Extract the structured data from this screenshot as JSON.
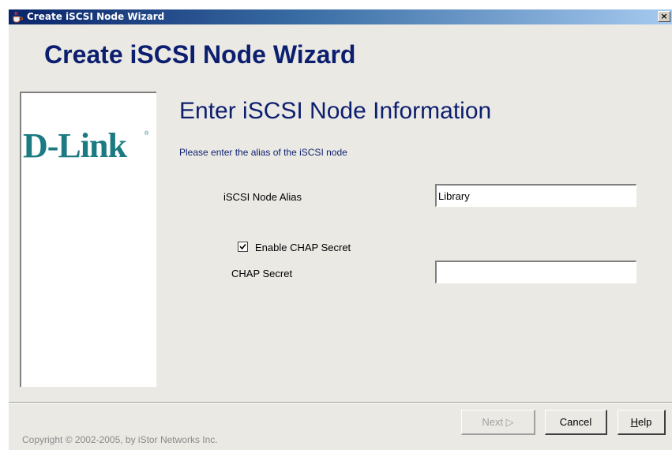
{
  "window": {
    "title": "Create iSCSI Node Wizard",
    "close_label": "×"
  },
  "wizard": {
    "heading": "Create iSCSI Node Wizard",
    "logo_text": "D-Link",
    "logo_reg": "®",
    "step_title": "Enter iSCSI Node Information",
    "instruction": "Please enter the alias of the iSCSI node"
  },
  "form": {
    "alias_label": "iSCSI Node Alias",
    "alias_value": "Library",
    "chap_enable_label": "Enable CHAP Secret",
    "chap_enable_checked": true,
    "chap_secret_label": "CHAP Secret",
    "chap_secret_value": ""
  },
  "footer": {
    "copyright": "Copyright © 2002-2005, by iStor Networks Inc."
  },
  "buttons": {
    "next_label": "Next ▷",
    "cancel_label": "Cancel",
    "help_mnemonic": "H",
    "help_rest": "elp"
  },
  "colors": {
    "heading": "#0c1f6f",
    "logo": "#1b7a82",
    "titlebar_start": "#0a246a",
    "background": "#ebe9e4"
  },
  "icons": {
    "title_icon": "java-cup-icon",
    "close_icon": "close-icon",
    "checkbox_icon": "checkmark-icon"
  }
}
